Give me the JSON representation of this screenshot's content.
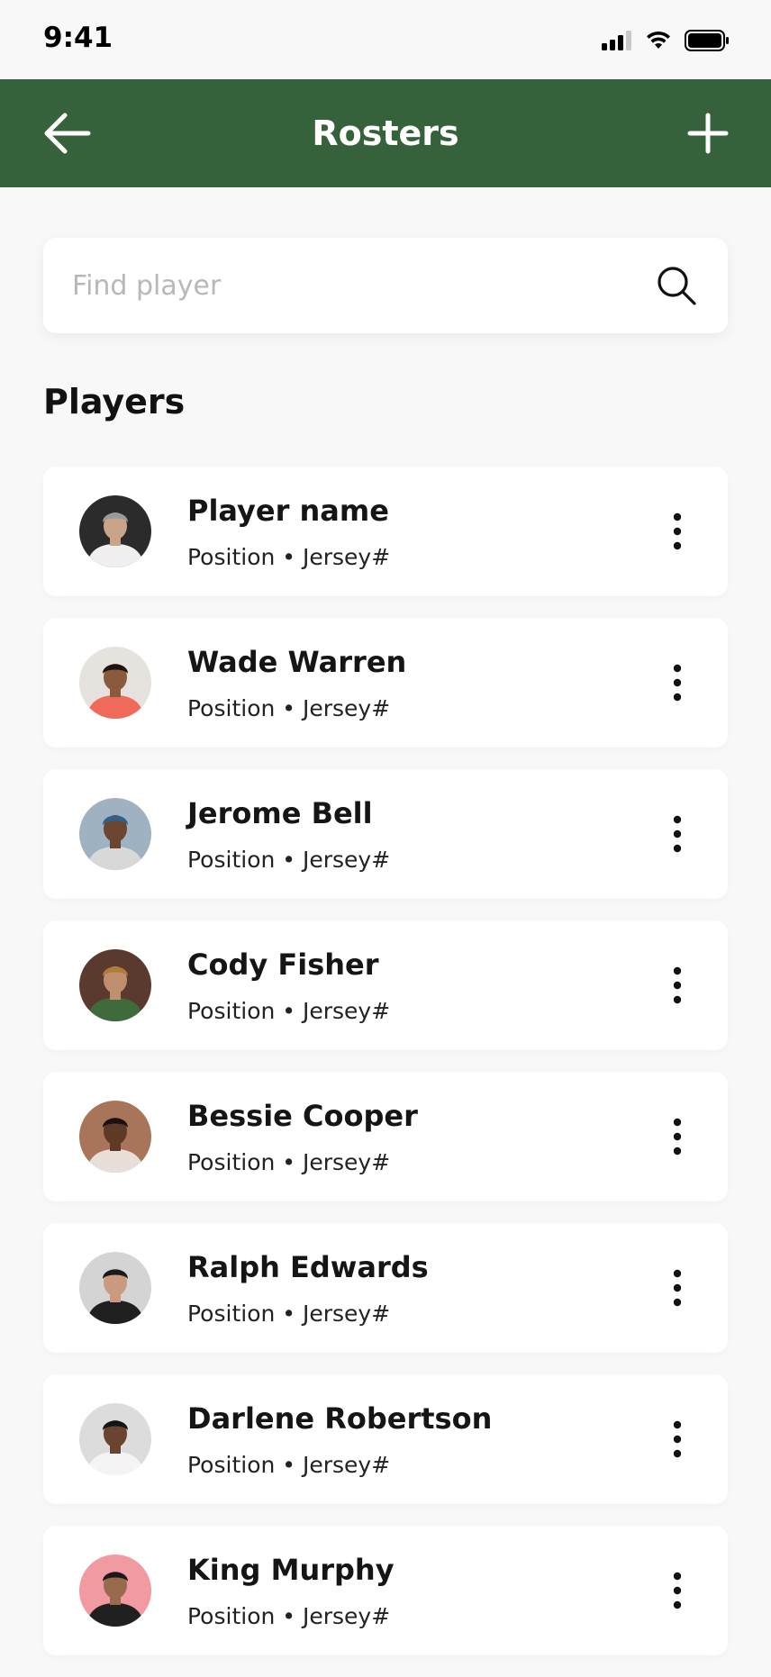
{
  "status_bar": {
    "time": "9:41"
  },
  "header": {
    "title": "Rosters"
  },
  "search": {
    "placeholder": "Find player",
    "value": ""
  },
  "section": {
    "title": "Players"
  },
  "players": [
    {
      "name": "Player name",
      "position": "Position",
      "jersey": "Jersey#",
      "avatar": {
        "bg": "#2b2b2b",
        "skin": "#c9a487",
        "hair": "#9a9a9a",
        "shirt": "#f0f0f0"
      }
    },
    {
      "name": "Wade Warren",
      "position": "Position",
      "jersey": "Jersey#",
      "avatar": {
        "bg": "#e6e2de",
        "skin": "#8a5a3c",
        "hair": "#1c1410",
        "shirt": "#f06a5c"
      }
    },
    {
      "name": "Jerome Bell",
      "position": "Position",
      "jersey": "Jersey#",
      "avatar": {
        "bg": "#9fb2c2",
        "skin": "#6b4530",
        "hair": "#2f5f8a",
        "shirt": "#d8d8d8"
      }
    },
    {
      "name": "Cody Fisher",
      "position": "Position",
      "jersey": "Jersey#",
      "avatar": {
        "bg": "#5a3a2e",
        "skin": "#c08f70",
        "hair": "#b07c3c",
        "shirt": "#3f6a3c"
      }
    },
    {
      "name": "Bessie Cooper",
      "position": "Position",
      "jersey": "Jersey#",
      "avatar": {
        "bg": "#a8745a",
        "skin": "#5e3a26",
        "hair": "#1a120e",
        "shirt": "#e8e0d8"
      }
    },
    {
      "name": "Ralph Edwards",
      "position": "Position",
      "jersey": "Jersey#",
      "avatar": {
        "bg": "#d4d4d4",
        "skin": "#c89a7e",
        "hair": "#1a1a1a",
        "shirt": "#1f1f1f"
      }
    },
    {
      "name": "Darlene Robertson",
      "position": "Position",
      "jersey": "Jersey#",
      "avatar": {
        "bg": "#dcdcdc",
        "skin": "#6a4430",
        "hair": "#141414",
        "shirt": "#f4f4f4"
      }
    },
    {
      "name": "King Murphy",
      "position": "Position",
      "jersey": "Jersey#",
      "avatar": {
        "bg": "#f29aa2",
        "skin": "#9a6a4e",
        "hair": "#1a1a1a",
        "shirt": "#202020"
      }
    }
  ],
  "colors": {
    "brand_green": "#36623b",
    "background": "#f8f8f8",
    "card": "#ffffff"
  },
  "icons": {
    "back": "arrow-left-icon",
    "add": "plus-icon",
    "search": "search-icon",
    "more": "more-vertical-icon"
  }
}
